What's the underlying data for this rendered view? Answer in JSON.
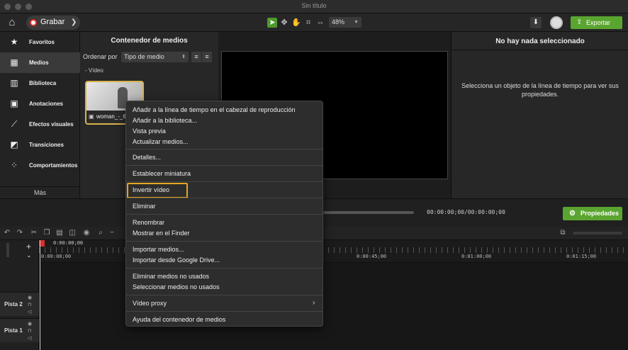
{
  "window": {
    "title": "Sin título"
  },
  "toolbar": {
    "home_icon": "home-icon",
    "record_label": "Grabar",
    "zoom_value": "48%",
    "export_label": "Exportar",
    "tools": [
      "pointer-icon",
      "pan-arrows-icon",
      "hand-icon",
      "crop-icon",
      "fit-icon"
    ]
  },
  "sidebar": {
    "items": [
      {
        "label": "Favoritos",
        "icon": "star-icon",
        "glyph": "★"
      },
      {
        "label": "Medios",
        "icon": "film-icon",
        "glyph": "▦"
      },
      {
        "label": "Biblioteca",
        "icon": "books-icon",
        "glyph": "▥"
      },
      {
        "label": "Anotaciones",
        "icon": "annotation-icon",
        "glyph": "▣"
      },
      {
        "label": "Efectos visuales",
        "icon": "magic-wand-icon",
        "glyph": "⟋"
      },
      {
        "label": "Transiciones",
        "icon": "transition-icon",
        "glyph": "◩"
      },
      {
        "label": "Comportamientos",
        "icon": "behaviors-icon",
        "glyph": "⁘"
      }
    ],
    "more_label": "Más",
    "add_label": "+"
  },
  "media": {
    "title": "Contenedor de medios",
    "sort_label": "Ordenar por",
    "sort_value": "Tipo de medio",
    "section_label": "-  Vídeo",
    "thumb_caption": "woman_-_6"
  },
  "properties": {
    "title": "No hay nada seleccionado",
    "description": "Selecciona un objeto de la línea de tiempo para ver sus propiedades.",
    "button_label": "Propiedades"
  },
  "player": {
    "timecode": "00:00:00;00/00:00:00;00"
  },
  "timeline": {
    "playhead_time": "0:00:00;00",
    "ticks": [
      "0:00:00;00",
      "0:00:45;00",
      "0:01:00;00",
      "0:01:15;00"
    ],
    "tracks": [
      "Pista 2",
      "Pista 1"
    ]
  },
  "context_menu": {
    "items": [
      "Añadir a la línea de tiempo en el cabezal de reproducción",
      "Añadir a la biblioteca...",
      "Vista previa",
      "Actualizar medios...",
      "Detalles...",
      "Establecer miniatura",
      "Invertir vídeo",
      "Eliminar",
      "Renombrar",
      "Mostrar en el Finder",
      "Importar medios...",
      "Importar desde Google Drive...",
      "Eliminar medios no usados",
      "Seleccionar medios no usados",
      "Vídeo proxy",
      "Ayuda del contenedor de medios"
    ],
    "highlight_color": "#e6a521"
  },
  "colors": {
    "accent": "#5aa52f",
    "record": "#e0322b",
    "selection": "#d8b24a"
  }
}
